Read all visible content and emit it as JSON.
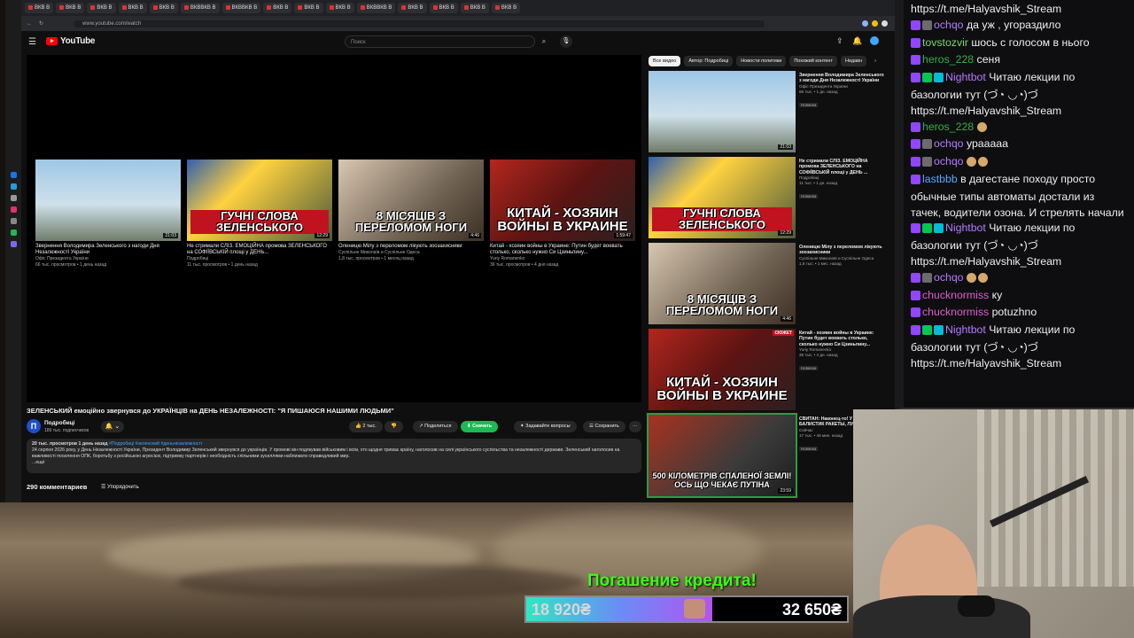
{
  "browser": {
    "tabs": [
      "ВКВ В",
      "ВКВ В",
      "ВКВ В",
      "ВКВ В",
      "ВКВ В",
      "ВКВВКВ В",
      "ВКВВКВ В",
      "ВКВ В",
      "ВКВ В",
      "ВКВ В",
      "ВКВВКВ В",
      "ВКВ В",
      "ВКВ В",
      "ВКВ В",
      "ВКВ В"
    ],
    "url": "www.youtube.com/watch"
  },
  "youtube": {
    "logo": "YouTube",
    "search_placeholder": "Поиск",
    "video_title": "ЗЕЛЕНСЬКИЙ емоційно звернувся до УКРАЇНЦІВ на ДЕНЬ НЕЗАЛЕЖНОСТІ: \"Я ПИШАЮСЯ НАШИМИ ЛЮДЬМИ\"",
    "channel": {
      "initial": "П",
      "name": "Подробиці",
      "subs": "189 тыс. подписчиков"
    },
    "actions": {
      "likes": "2 тыс.",
      "share": "Поделиться",
      "download": "Скачать",
      "ask": "Задавайте вопросы",
      "save": "Сохранить",
      "more": "···"
    },
    "description": {
      "meta": "20 тыс. просмотров  1 день назад ",
      "tags": "#Подробиці #зеленский #деньнезалежності",
      "text": "24 серпня 2026 року, у День Незалежності України, Президент Володимир Зеленський звернувся до українців. У промові він подякував військовим і всім, хто щодня тримає країну, наголосив на силі українського суспільства та незалежності держави. Зеленський наголосив на важливості посилення ОПК, боротьбу з російською агресією, підтримку партнерів і необхідність спільними зусиллями наближати справедливий мир.",
      "more": "...ещё"
    },
    "comments_count": "290 комментариев",
    "sort_label": "Упорядочить",
    "endcards": [
      {
        "title": "Звернення Володимира Зеленського з нагоди Дня Незалежності України",
        "channel": "Офіс Президента України",
        "meta": "66 тыс. просмотров • 1 день назад",
        "duration": "21:03",
        "thumb_text": ""
      },
      {
        "title": "Не стримали СЛІЗ. ЕМОЦІЙНА промова ЗЕЛЕНСЬКОГО на СОФІЇВСЬКІЙ площі у ДЕНЬ...",
        "channel": "Подробиці",
        "meta": "11 тыс. просмотров • 1 день назад",
        "duration": "12:29",
        "thumb_text": "ГУЧНІ СЛОВА ЗЕЛЕНСЬКОГО"
      },
      {
        "title": "Оленицю Мілу з переломом лікують зоозахисники",
        "channel": "Суспільне Миколаїв и Суспільне Одеса",
        "meta": "1,8 тыс. просмотров • 1 месяц назад",
        "duration": "4:46",
        "thumb_text": "8 МІСЯЦІВ З ПЕРЕЛОМОМ НОГИ"
      },
      {
        "title": "Китай - хозяин войны в Украине: Путин будет воевать столько, сколько нужно Си Цзиньпину...",
        "channel": "Yuriy Romanenko",
        "meta": "36 тыс. просмотров • 4 дня назад",
        "duration": "1:59:47",
        "thumb_text": "КИТАЙ - ХОЗЯИН ВОЙНЫ В УКРАИНЕ"
      }
    ],
    "chips": [
      "Все видео",
      "Автор: Подробиці",
      "Новости политики",
      "Похожий контент",
      "Недавн"
    ],
    "recommendations": [
      {
        "title": "Звернення Володимира Зеленського з нагоди Дня Незалежності України",
        "channel": "Офіс Президента України",
        "meta": "66 тыс. • 1 дн. назад",
        "badge": "Новинка",
        "duration": "21:03",
        "thumb_text": ""
      },
      {
        "title": "Не стримали СЛІЗ. ЕМОЦІЙНА промова ЗЕЛЕНСЬКОГО на СОФІЇВСЬКІЙ площі у ДЕНЬ ...",
        "channel": "Подробиці",
        "meta": "11 тыс. • 1 дн. назад",
        "badge": "Новинка",
        "duration": "12:29",
        "thumb_text": "ГУЧНІ СЛОВА ЗЕЛЕНСЬКОГО"
      },
      {
        "title": "Оленицю Мілу з переломом лікують зоозахисники",
        "channel": "Суспільне Миколаїв и Суспільне Одеса",
        "meta": "1,8 тыс. • 1 мес. назад",
        "badge": "",
        "duration": "4:46",
        "thumb_text": "8 МІСЯЦІВ З ПЕРЕЛОМОМ НОГИ"
      },
      {
        "title": "Китай - хозяин войны в Украине: Путин будет воевать столько, сколько нужно Си Цзиньпину...",
        "channel": "Yuriy Romanenko",
        "meta": "36 тыс. • 4 дн. назад",
        "badge": "Новинка",
        "duration": "",
        "thumb_text": "КИТАЙ - ХОЗЯИН ВОЙНЫ В УКРАИНЕ",
        "tag": "СЮЖЕТ"
      },
      {
        "title": "СВИТАН: Наконец-то! У СПАСЛИ ОТ БАЛИСТИК РАКЕТЫ, ЛУЧШЕ PATRI",
        "channel": "Сейчас",
        "meta": "17 тыс. • 46 мин. назад",
        "badge": "Новинка",
        "duration": "23:59",
        "thumb_text": "500 КІЛОМЕТРІВ СПАЛЕНОЇ ЗЕМЛІ! ОСЬ ЩО ЧЕКАЄ ПУТІНА"
      }
    ]
  },
  "chat": [
    {
      "user": "",
      "color": "#efeff1",
      "badges": [],
      "text": "https://t.me/Halyavshik_Stream"
    },
    {
      "user": "ochqo",
      "color": "#b57bff",
      "badges": [
        "twitch",
        "gray"
      ],
      "text": "да уж , угораздило"
    },
    {
      "user": "tovstozvir",
      "color": "#7fd36f",
      "badges": [
        "twitch"
      ],
      "text": "шось с голосом в нього"
    },
    {
      "user": "heros_228",
      "color": "#2fb24a",
      "badges": [
        "twitch"
      ],
      "text": "сеня"
    },
    {
      "user": "Nightbot",
      "color": "#b57bff",
      "badges": [
        "twitch",
        "green",
        "cyan"
      ],
      "text": "Читаю лекции по базологии тут (づ◔ ◡◔)づ https://t.me/Halyavshik_Stream"
    },
    {
      "user": "heros_228",
      "color": "#2fb24a",
      "badges": [
        "twitch"
      ],
      "text": ""
    },
    {
      "user": "ochqo",
      "color": "#b57bff",
      "badges": [
        "twitch",
        "gray"
      ],
      "text": "урааааа"
    },
    {
      "user": "ochqo",
      "color": "#b57bff",
      "badges": [
        "twitch",
        "gray"
      ],
      "text": ""
    },
    {
      "user": "lastbbb",
      "color": "#5aa7ff",
      "badges": [
        "twitch"
      ],
      "text": "в дагестане походу просто обычные типы автоматы достали из тачек, водители озона. И стрелять начали"
    },
    {
      "user": "Nightbot",
      "color": "#b57bff",
      "badges": [
        "twitch",
        "green",
        "cyan"
      ],
      "text": "Читаю лекции по базологии тут (づ◔ ◡◔)づ https://t.me/Halyavshik_Stream"
    },
    {
      "user": "ochqo",
      "color": "#b57bff",
      "badges": [
        "twitch",
        "gray"
      ],
      "text": ""
    },
    {
      "user": "chucknormiss",
      "color": "#e05cd1",
      "badges": [
        "twitch"
      ],
      "text": "ку"
    },
    {
      "user": "chucknormiss",
      "color": "#e05cd1",
      "badges": [
        "twitch"
      ],
      "text": "potuzhno"
    },
    {
      "user": "Nightbot",
      "color": "#b57bff",
      "badges": [
        "twitch",
        "green",
        "cyan"
      ],
      "text": "Читаю лекции по базологии тут (づ◔ ◡◔)づ https://t.me/Halyavshik_Stream"
    }
  ],
  "donation": {
    "title": "Погашение кредита!",
    "current": "18 920₴",
    "goal": "32 650₴",
    "progress": 0.58
  }
}
